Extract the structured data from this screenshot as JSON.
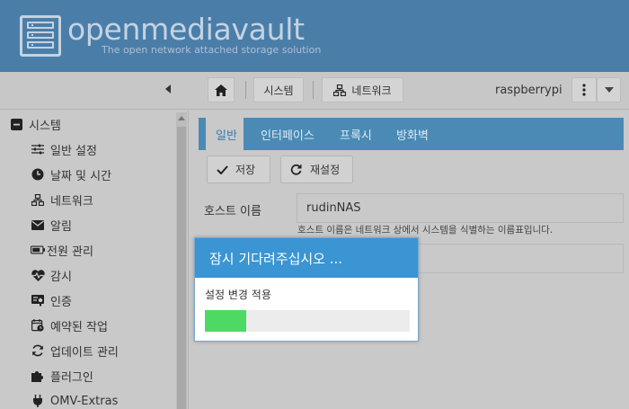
{
  "header": {
    "title": "openmediavault",
    "subtitle": "The open network attached storage solution"
  },
  "toolbar": {
    "breadcrumb": [
      {
        "label": "시스템",
        "icon": "home-icon"
      },
      {
        "label": "네트워크",
        "icon": "network-icon"
      }
    ],
    "hostname": "raspberrypi"
  },
  "sidebar": {
    "items": [
      {
        "label": "시스템",
        "icon": "minus-square-icon"
      },
      {
        "label": "일반 설정",
        "icon": "sliders-icon"
      },
      {
        "label": "날짜 및 시간",
        "icon": "clock-icon"
      },
      {
        "label": "네트워크",
        "icon": "network-icon"
      },
      {
        "label": "알림",
        "icon": "envelope-icon"
      },
      {
        "label": "전원 관리",
        "icon": "battery-icon"
      },
      {
        "label": "감시",
        "icon": "heartbeat-icon"
      },
      {
        "label": "인증",
        "icon": "certificate-icon"
      },
      {
        "label": "예약된 작업",
        "icon": "calendar-clock-icon"
      },
      {
        "label": "업데이트 관리",
        "icon": "refresh-icon"
      },
      {
        "label": "플러그인",
        "icon": "puzzle-icon"
      },
      {
        "label": "OMV-Extras",
        "icon": "plug-icon"
      }
    ]
  },
  "main": {
    "tabs": [
      "일반",
      "인터페이스",
      "프록시",
      "방화벽"
    ],
    "active_tab": "일반",
    "save_label": "저장",
    "reset_label": "재설정",
    "hostname_label": "호스트 이름",
    "hostname_value": "rudinNAS",
    "hostname_hint": "호스트 이름은 네트워크 상에서 시스템을 식별하는 이름표입니다."
  },
  "modal": {
    "title": "잠시 기다려주십시오 ...",
    "message": "설정 변경 적용",
    "progress": 0.2
  },
  "colors": {
    "header_bg": "#4a7ea9",
    "tab_bar": "#4a8ab5",
    "modal_header": "#3a95d2",
    "progress_fill": "#4cd964"
  }
}
